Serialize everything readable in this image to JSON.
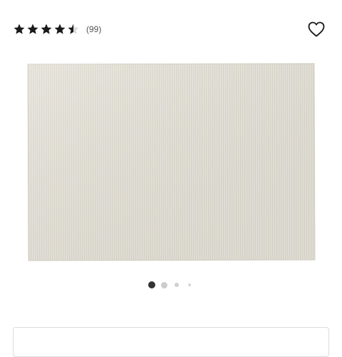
{
  "product": {
    "rating": 4.5,
    "rating_max": 5,
    "review_count": "(99)",
    "wishlist_icon": "heart-outline-icon"
  },
  "gallery": {
    "image_description_icon": "rug-image",
    "slide_count": 4,
    "active_slide": 1
  },
  "colors": {
    "star": "#1a1a1a",
    "star_empty": "#d9d9d9",
    "dot_active": "#333333",
    "dot_inactive": "#cccccc",
    "rug": "#e6e3da"
  }
}
